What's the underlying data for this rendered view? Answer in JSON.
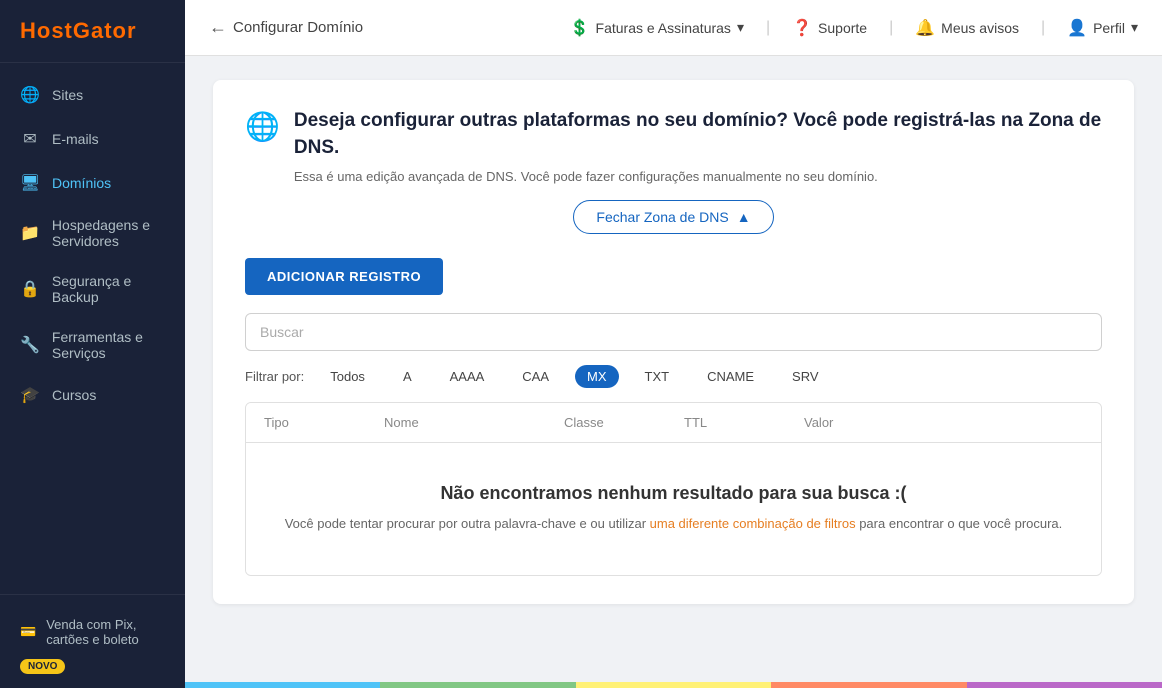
{
  "app": {
    "name": "HostGator"
  },
  "sidebar": {
    "items": [
      {
        "id": "sites",
        "label": "Sites",
        "icon": "🌐"
      },
      {
        "id": "emails",
        "label": "E-mails",
        "icon": "✉"
      },
      {
        "id": "dominios",
        "label": "Domínios",
        "icon": "🖥",
        "active": true
      },
      {
        "id": "hospedagens",
        "label": "Hospedagens e Servidores",
        "icon": "📁"
      },
      {
        "id": "seguranca",
        "label": "Segurança e Backup",
        "icon": "🔒"
      },
      {
        "id": "ferramentas",
        "label": "Ferramentas e Serviços",
        "icon": "🔧"
      },
      {
        "id": "cursos",
        "label": "Cursos",
        "icon": "🎓"
      }
    ],
    "bottom": {
      "label": "Venda com Pix, cartões e boleto",
      "badge": "NOVO",
      "icon": "💳"
    }
  },
  "topbar": {
    "back_label": "Configurar Domínio",
    "actions": [
      {
        "id": "faturas",
        "label": "Faturas e Assinaturas",
        "icon": "💲",
        "has_arrow": true
      },
      {
        "id": "suporte",
        "label": "Suporte",
        "icon": "❓"
      },
      {
        "id": "avisos",
        "label": "Meus avisos",
        "icon": "🔔"
      },
      {
        "id": "perfil",
        "label": "Perfil",
        "icon": "👤",
        "has_arrow": true
      }
    ]
  },
  "content": {
    "banner": {
      "icon": "🌐",
      "title": "Deseja configurar outras plataformas no seu domínio? Você pode registrá-las na Zona de DNS.",
      "subtitle": "Essa é uma edição avançada de DNS. Você pode fazer configurações manualmente no seu domínio."
    },
    "close_zone_btn": "Fechar Zona de DNS",
    "add_record_btn": "ADICIONAR REGISTRO",
    "search_placeholder": "Buscar",
    "filter_label": "Filtrar por:",
    "filters": [
      {
        "id": "todos",
        "label": "Todos",
        "active": false
      },
      {
        "id": "a",
        "label": "A",
        "active": false
      },
      {
        "id": "aaaa",
        "label": "AAAA",
        "active": false
      },
      {
        "id": "caa",
        "label": "CAA",
        "active": false
      },
      {
        "id": "mx",
        "label": "MX",
        "active": true
      },
      {
        "id": "txt",
        "label": "TXT",
        "active": false
      },
      {
        "id": "cname",
        "label": "CNAME",
        "active": false
      },
      {
        "id": "srv",
        "label": "SRV",
        "active": false
      }
    ],
    "table": {
      "headers": [
        "Tipo",
        "Nome",
        "Classe",
        "TTL",
        "Valor"
      ],
      "empty_title": "Não encontramos nenhum resultado para sua busca :(",
      "empty_message": "Você pode tentar procurar por outra palavra-chave e ou utilizar uma diferente combinação de filtros para encontrar o que você procura."
    }
  },
  "footer": {
    "colors": [
      "#4fc3f7",
      "#81c784",
      "#fff176",
      "#ff8a65",
      "#ba68c8"
    ]
  }
}
